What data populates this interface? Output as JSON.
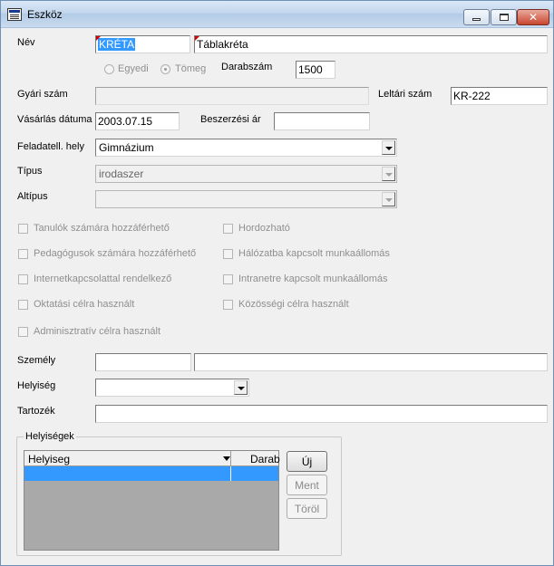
{
  "window": {
    "title": "Eszköz",
    "close_glyph": "✕"
  },
  "fields": {
    "nev_label": "Név",
    "nev_code": "KRÉTA",
    "nev_name": "Táblakréta",
    "radio_egyedi": "Egyedi",
    "radio_tomeg": "Tömeg",
    "darabszam_label": "Darabszám",
    "darabszam_value": "1500",
    "gyari_szam_label": "Gyári szám",
    "gyari_szam_value": "",
    "leltari_szam_label": "Leltári szám",
    "leltari_szam_value": "KR-222",
    "vasarlas_label": "Vásárlás dátuma",
    "vasarlas_value": "2003.07.15",
    "beszerzesi_label": "Beszerzési ár",
    "beszerzesi_value": "",
    "feladatell_label": "Feladatell. hely",
    "feladatell_value": "Gimnázium",
    "tipus_label": "Típus",
    "tipus_value": "irodaszer",
    "altipus_label": "Altípus",
    "altipus_value": "",
    "szemely_label": "Személy",
    "helyiseg_label": "Helyiség",
    "tartozek_label": "Tartozék"
  },
  "checkboxes": {
    "tanulok": "Tanulók számára hozzáférhető",
    "pedagogusok": "Pedagógusok számára hozzáférhető",
    "internet": "Internetkapcsolattal rendelkező",
    "oktatasi": "Oktatási célra használt",
    "adminisztrativ": "Adminisztratív célra használt",
    "hordozhato": "Hordozható",
    "halozatba": "Hálózatba kapcsolt munkaállomás",
    "intranetre": "Intranetre kapcsolt munkaállomás",
    "kozossegi": "Közösségi célra használt"
  },
  "group": {
    "title": "Helyiségek",
    "col_helyiseg": "Helyiseg",
    "col_darab": "Darab",
    "btn_uj": "Új",
    "btn_ment": "Ment",
    "btn_torol": "Töröl"
  }
}
